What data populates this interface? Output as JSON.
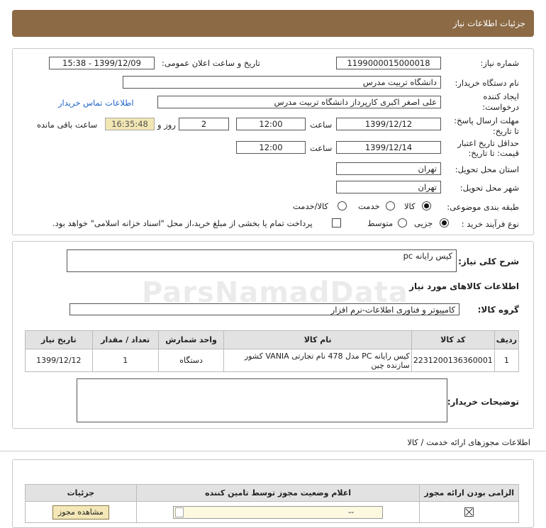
{
  "header": {
    "title": "جزئیات اطلاعات نیاز"
  },
  "details": {
    "need_number_label": "شماره نیاز:",
    "need_number": "1199000015000018",
    "announce_label": "تاریخ و ساعت اعلان عمومی:",
    "announce_value": "1399/12/09 - 15:38",
    "buyer_label": "نام دستگاه خریدار:",
    "buyer_value": "دانشگاه تربیت مدرس",
    "creator_label_1": "ایجاد کننده",
    "creator_label_2": "درخواست:",
    "creator_value": "علی اصغر اکبری کارپرداز دانشگاه تربیت مدرس",
    "contact_link": "اطلاعات تماس خریدار",
    "reply_label_1": "مهلت ارسال پاسخ:",
    "reply_label_2": "تا تاریخ:",
    "reply_date": "1399/12/12",
    "time_label": "ساعت",
    "reply_time": "12:00",
    "days_value": "2",
    "days_label": "روز و",
    "remaining_value": "16:35:48",
    "remaining_label": "ساعت باقی مانده",
    "price_label_1": "حداقل تاریخ اعتبار",
    "price_label_2": "قیمت: تا تاریخ:",
    "price_date": "1399/12/14",
    "price_time": "12:00",
    "province_label": "استان محل تحویل:",
    "province_value": "تهران",
    "city_label": "شهر محل تحویل:",
    "city_value": "تهران",
    "category_label": "طبقه بندی موضوعی:",
    "category_options": [
      "کالا",
      "خدمت",
      "کالا/خدمت"
    ],
    "process_label": "نوع فرآیند خرید :",
    "process_options": [
      "جزیی",
      "متوسط"
    ],
    "payment_note": "پرداخت تمام یا بخشی از مبلغ خرید،از محل \"اسناد خزانه اسلامی\" خواهد بود."
  },
  "summary": {
    "general_desc_label": "شرح کلی نیاز:",
    "general_desc_value": "کیس رایانه pc",
    "goods_info_title": "اطلاعات کالاهای مورد نیاز",
    "group_label": "گروه کالا:",
    "group_value": "کامپیوتر و فناوری اطلاعات-نرم افزار"
  },
  "goods_table": {
    "headers": [
      "ردیف",
      "کد کالا",
      "نام کالا",
      "واحد شمارش",
      "تعداد / مقدار",
      "تاریخ نیاز"
    ],
    "rows": [
      [
        "1",
        "2231200136360001",
        "کیس رایانه PC مدل 478 نام تجارتی VANIA کشور سازنده چین",
        "دستگاه",
        "1",
        "1399/12/12"
      ]
    ]
  },
  "buyer_notes_label": "توضیحات خریدار:",
  "permits": {
    "title": "اطلاعات مجوزهای ارائه خدمت / کالا",
    "headers": [
      "الزامی بودن ارائه مجوز",
      "اعلام وضعیت مجوز توسط تامین کننده",
      "جزئیات"
    ],
    "status_value": "--",
    "view_button": "مشاهده مجوز"
  },
  "watermark": "ParsNamadData"
}
